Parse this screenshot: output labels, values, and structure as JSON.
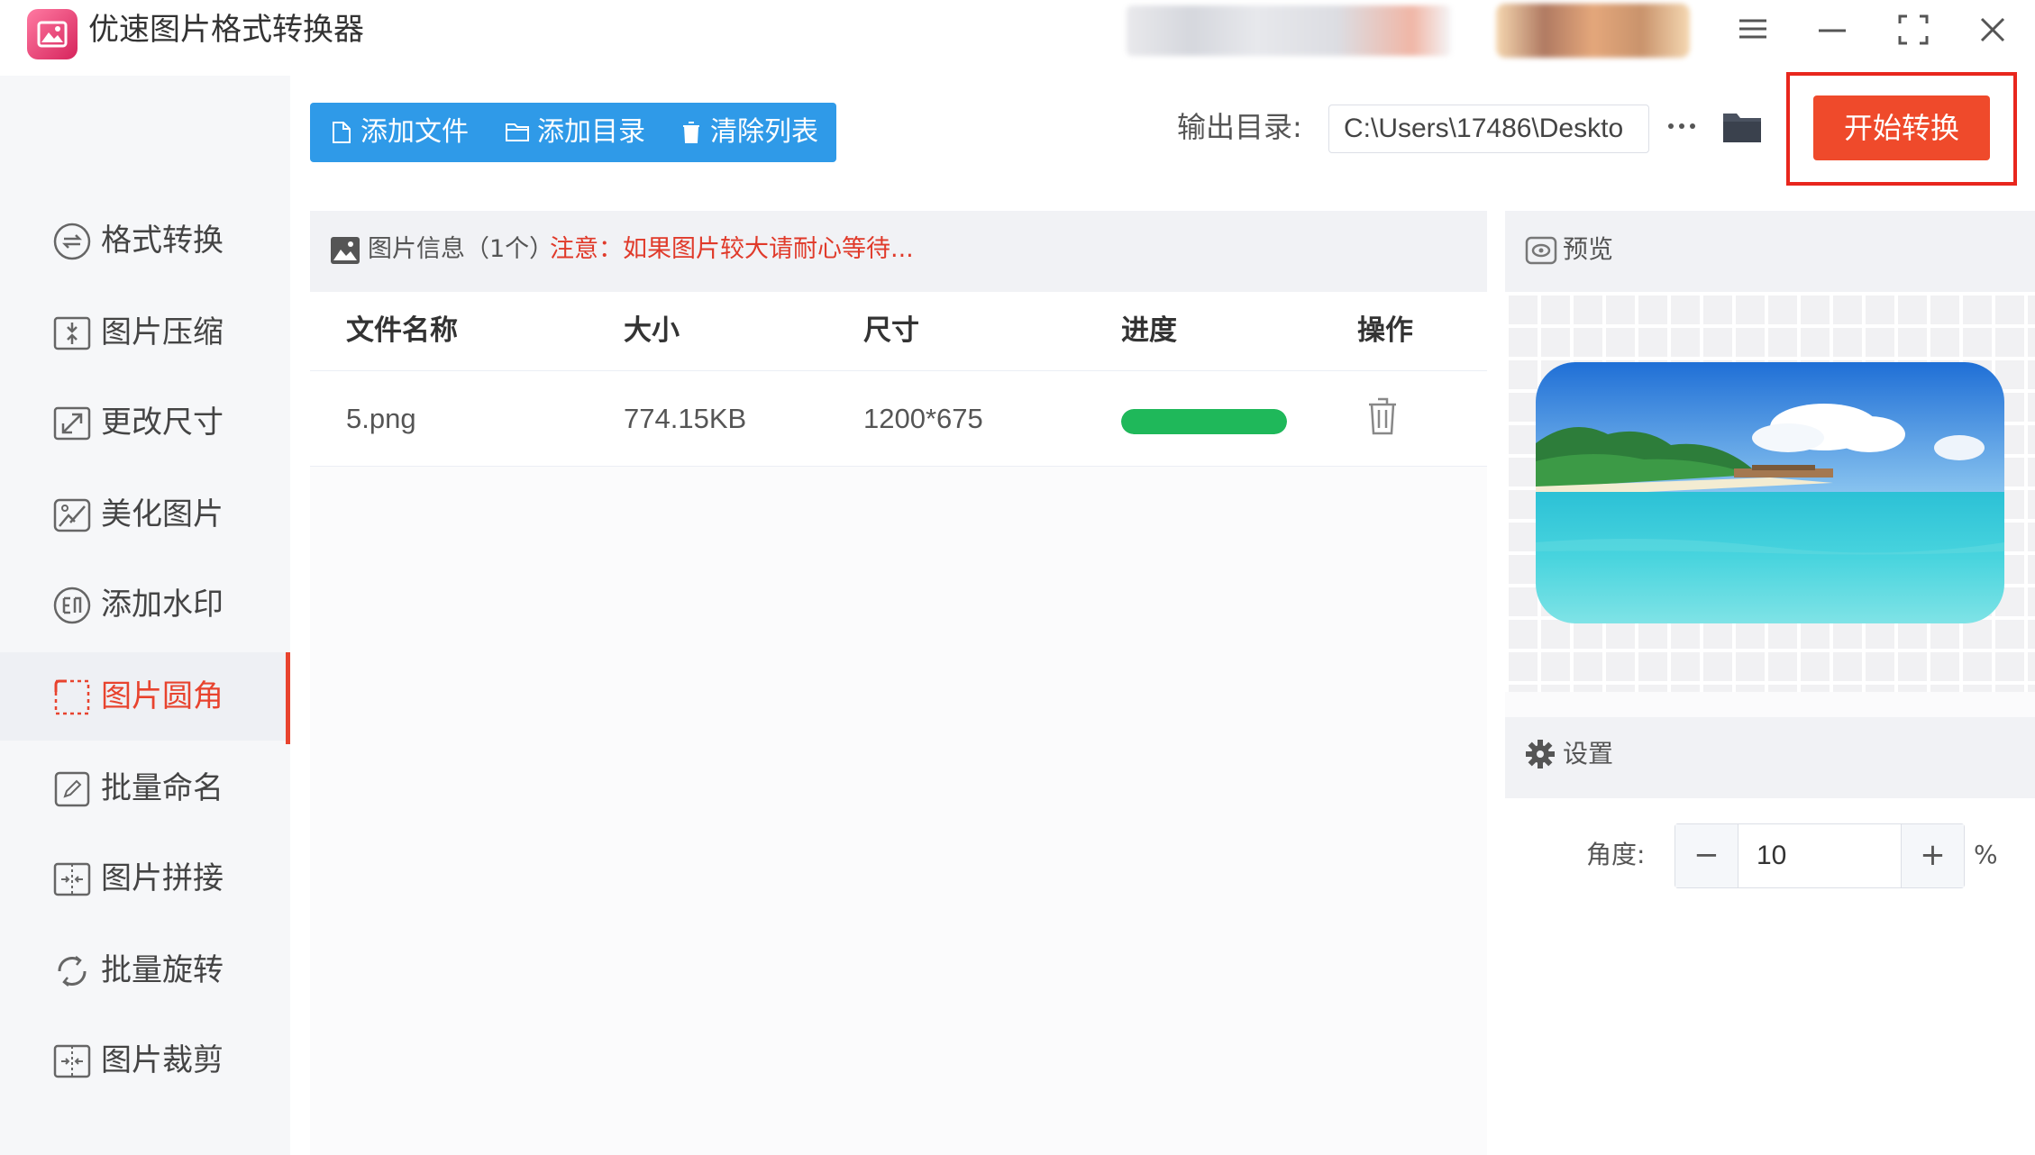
{
  "app": {
    "title": "优速图片格式转换器"
  },
  "sidebar": {
    "active_index": 5,
    "items": [
      {
        "label": "格式转换",
        "icon": "format-convert-icon"
      },
      {
        "label": "图片压缩",
        "icon": "compress-icon"
      },
      {
        "label": "更改尺寸",
        "icon": "resize-icon"
      },
      {
        "label": "美化图片",
        "icon": "beautify-icon"
      },
      {
        "label": "添加水印",
        "icon": "watermark-icon"
      },
      {
        "label": "图片圆角",
        "icon": "round-corner-icon"
      },
      {
        "label": "批量命名",
        "icon": "rename-icon"
      },
      {
        "label": "图片拼接",
        "icon": "stitch-icon"
      },
      {
        "label": "批量旋转",
        "icon": "rotate-icon"
      },
      {
        "label": "图片裁剪",
        "icon": "crop-icon"
      }
    ]
  },
  "toolbar": {
    "add_file": "添加文件",
    "add_folder": "添加目录",
    "clear_list": "清除列表",
    "output_label": "输出目录:",
    "output_path": "C:\\Users\\17486\\Deskto",
    "more": "···",
    "start": "开始转换"
  },
  "file_panel": {
    "info_label": "图片信息（1个）",
    "info_note": "注意：如果图片较大请耐心等待...",
    "columns": [
      "文件名称",
      "大小",
      "尺寸",
      "进度",
      "操作"
    ],
    "rows": [
      {
        "name": "5.png",
        "size": "774.15KB",
        "dimensions": "1200*675",
        "progress": 1.0
      }
    ]
  },
  "preview": {
    "label": "预览"
  },
  "settings": {
    "label": "设置",
    "angle_label": "角度:",
    "angle_value": "10",
    "unit": "%",
    "minus": "−",
    "plus": "+"
  },
  "colors": {
    "accent_blue": "#2f9ae8",
    "start_red": "#ef4a2b",
    "active_red": "#e8432e",
    "progress_green": "#1fb85a"
  }
}
